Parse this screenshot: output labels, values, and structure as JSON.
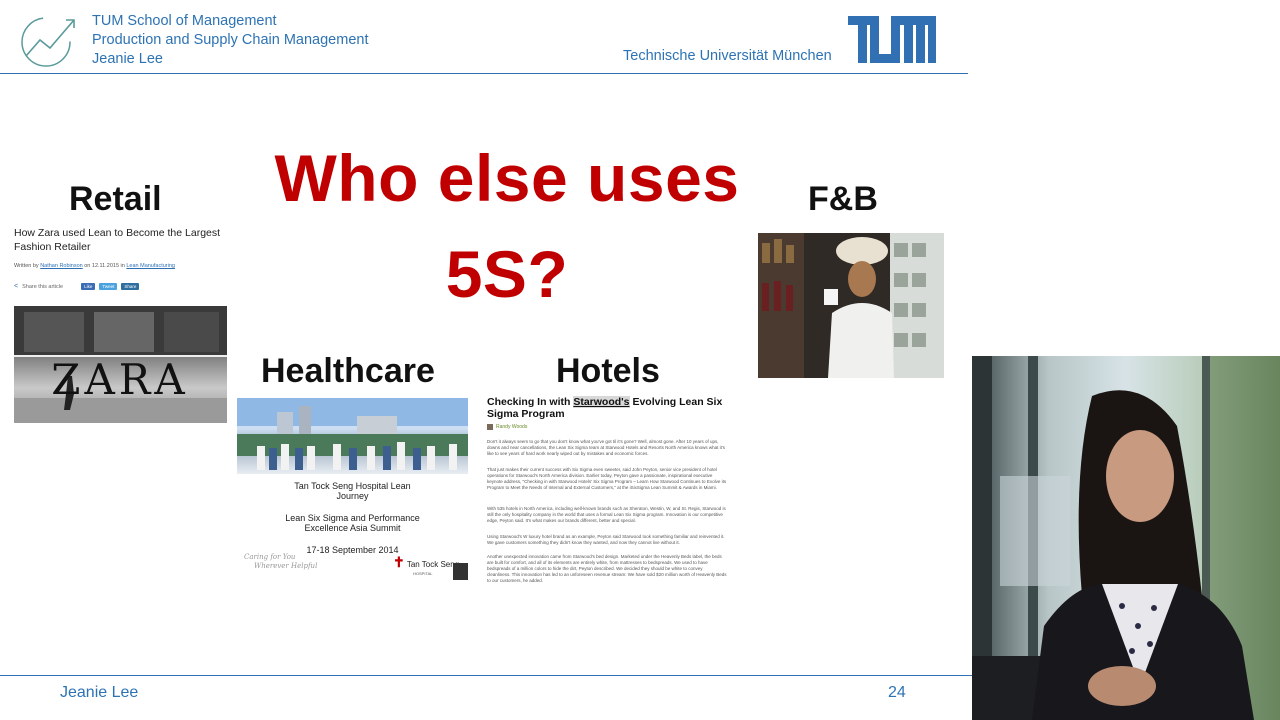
{
  "header": {
    "line1": "TUM School of Management",
    "line2": "Production and Supply Chain Management",
    "line3": "Jeanie Lee",
    "university": "Technische Universität München"
  },
  "slide": {
    "title_line1": "Who else uses",
    "title_line2": "5S?",
    "retail": {
      "label": "Retail",
      "headline": "How Zara used Lean to Become the Largest Fashion Retailer",
      "byline_pre": "Written by",
      "byline_author": "Nathan Robinson",
      "byline_mid": "on 12.11.2015 in",
      "byline_cat": "Lean Manufacturing",
      "share_text": "Share this article",
      "share_buttons": [
        "Like",
        "Tweet",
        "Share"
      ],
      "photo_sign": "ZARA"
    },
    "healthcare": {
      "label": "Healthcare",
      "line1": "Tan Tock Seng Hospital Lean",
      "line2": "Journey",
      "line3": "Lean Six Sigma and Performance",
      "line4": "Excellence Asia Summit",
      "date": "17-18 September 2014",
      "signature_line1": "Caring for You",
      "signature_line2": "Wherever Helpful",
      "logo_text": "Tan Tock Seng",
      "logo_sub": "HOSPITAL"
    },
    "hotels": {
      "label": "Hotels",
      "title_pre": "Checking In with",
      "title_highlight": "Starwood's",
      "title_post": "Evolving Lean Six Sigma Program",
      "author": "Randy Woods",
      "paragraphs": [
        "Don't it always seem to go that you don't know what you've got til it's gone? Well, almost gone. After 10 years of ups, downs and near cancellations, the Lean Six Sigma team at Starwood Hotels and Resorts North America knows what it's like to see years of hard work nearly wiped out by mistakes and economic forces.",
        "That just makes their current success with Six Sigma even sweeter, said John Peyton, senior vice president of hotel operations for Starwood's North America division. Earlier today, Peyton gave a passionate, inspirational executive keynote address, \"Checking in with Starwood Hotels' Six Sigma Program – Learn How Starwood Continues to Evolve its Program to Meet the Needs of Internal and External Customers,\" at the iSixSigma Lean Summit & Awards in Miami.",
        "With 535 hotels in North America, including well-known brands such as Sheraton, Westin, W, and St. Regis, Starwood is still the only hospitality company in the world that uses a formal Lean Six Sigma program. Innovation is our competitive edge, Peyton said. It's what makes our brands different, better and special.",
        "Using Starwood's W luxury hotel brand as an example, Peyton said Starwood took something familiar and reinvented it. We gave customers something they didn't know they wanted, and now they cannot live without it.",
        "Another unexpected innovation came from Starwood's bed design. Marketed under the Heavenly Beds label, the beds are built for comfort, and all of its elements are entirely white, from mattresses to bedspreads. We used to have bedspreads of a million colors to hide the dirt, Peyton described. We decided they should be white to convey cleanliness. This innovation has led to an unforeseen revenue stream: We have sold $20 million worth of Heavenly Beds to our customers, he added."
      ]
    },
    "fnb": {
      "label": "F&B"
    }
  },
  "footer": {
    "presenter": "Jeanie Lee",
    "page_number": "24"
  },
  "colors": {
    "tum_blue": "#3070b3",
    "title_red": "#c00000"
  }
}
